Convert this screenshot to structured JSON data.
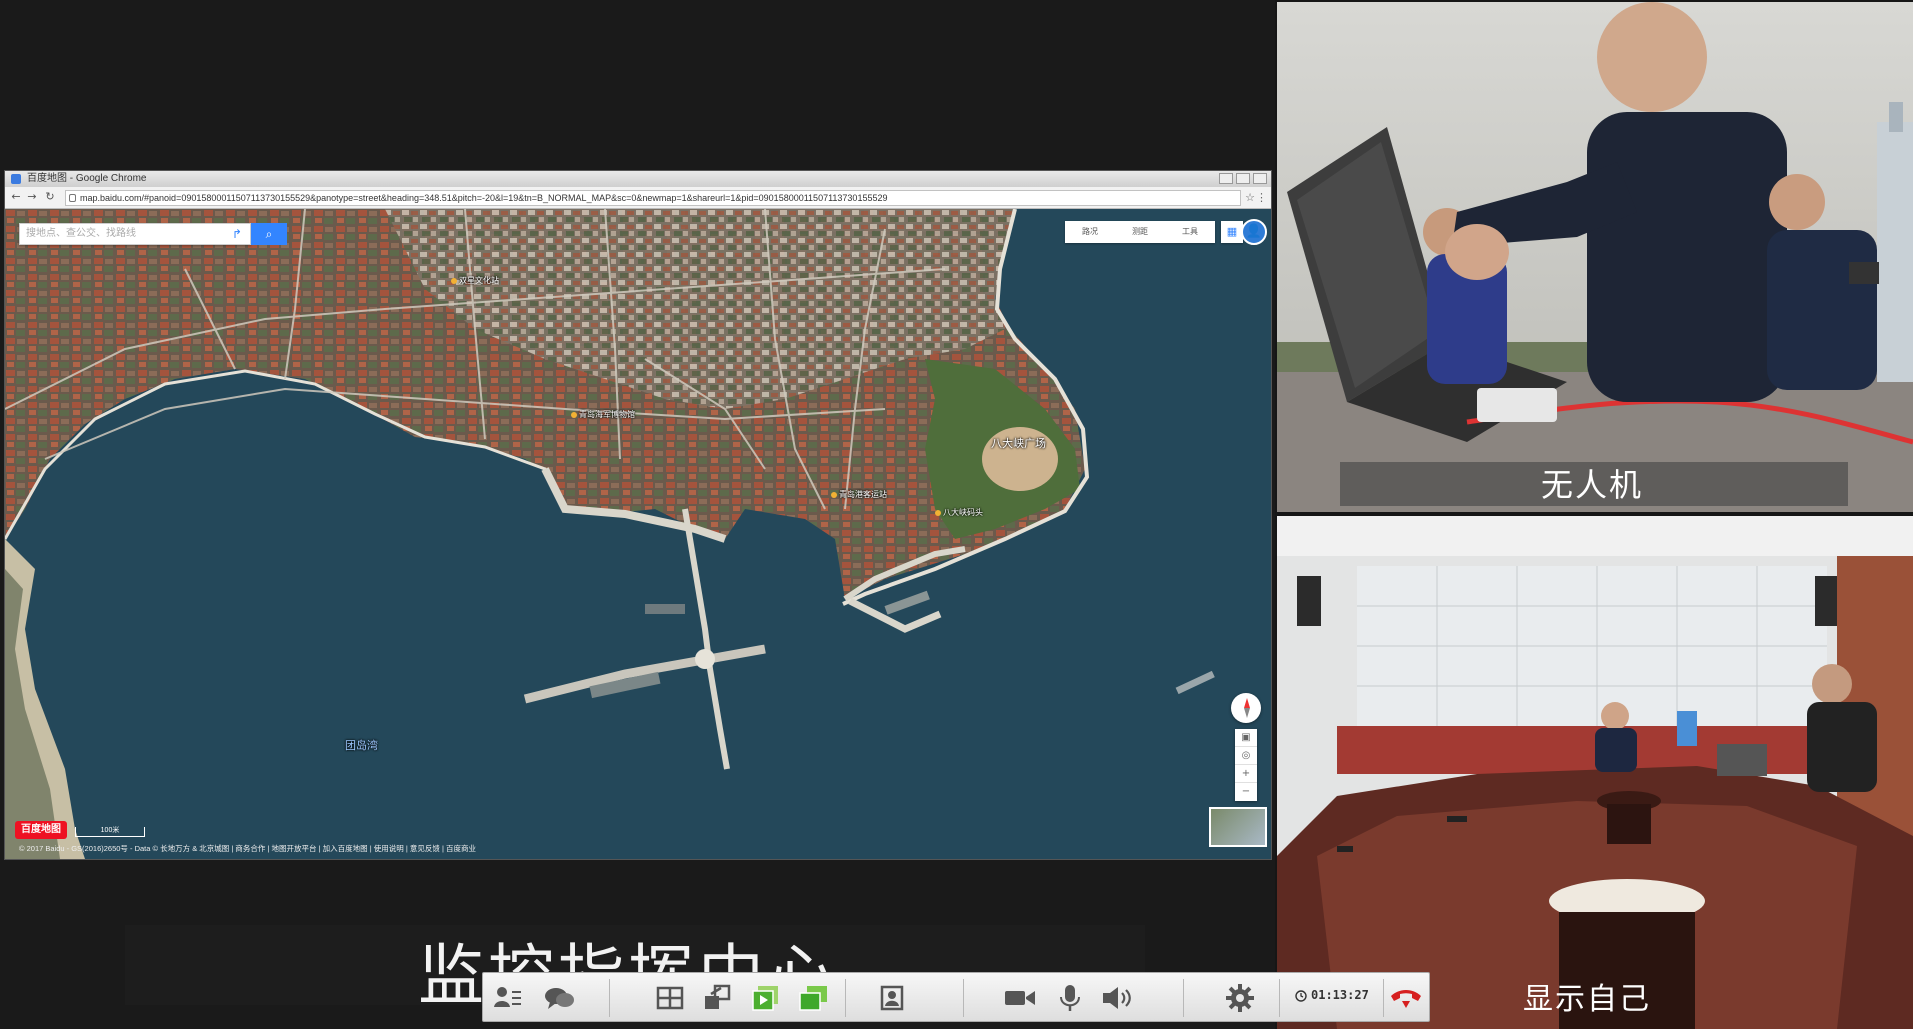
{
  "main_share": {
    "caption": "监控指挥中心",
    "browser": {
      "window_title": "百度地图 - Google Chrome",
      "url": "map.baidu.com/#panoid=09015800011507113730155529&panotype=street&heading=348.51&pitch=-20&l=19&tn=B_NORMAL_MAP&sc=0&newmap=1&shareurl=1&pid=09015800011507113730155529",
      "map": {
        "search_placeholder": "搜地点、查公交、找路线",
        "search_button_icon": "magnifier-icon",
        "tools": [
          "路况",
          "测距",
          "工具"
        ],
        "labels": {
          "square": "八大峡广场",
          "bay": "团岛湾",
          "culture": "双星文化站",
          "museum": "青岛海军博物馆",
          "terminal": "青岛港客运站",
          "pier": "八大峡码头"
        },
        "scale": "100米",
        "logo": "百度地图",
        "copyright": "© 2017 Baidu - GS(2016)2650号 - Data © 长地万方 & 北京城图 | 商务合作 | 地图开放平台 | 加入百度地图 | 使用说明 | 意见反馈 | 百度商业"
      }
    }
  },
  "videos": [
    {
      "caption": "无人机"
    },
    {
      "caption": "显示自己"
    }
  ],
  "control_bar": {
    "timer": "01:13:27",
    "buttons": [
      "participants-icon",
      "chat-icon",
      "layout-icon",
      "share-screen-icon",
      "record-icon",
      "video-sync-icon",
      "roster-icon",
      "camera-icon",
      "microphone-icon",
      "speaker-icon",
      "settings-icon",
      "hangup-icon"
    ]
  }
}
